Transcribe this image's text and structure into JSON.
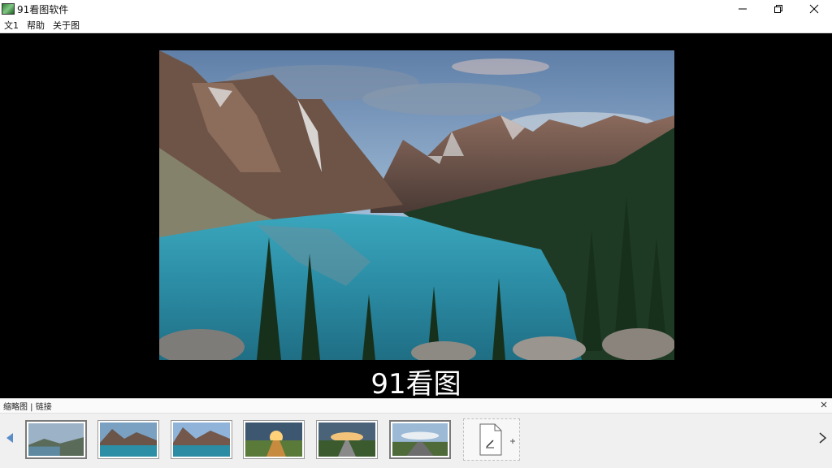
{
  "window": {
    "title": "91看图软件"
  },
  "menu": {
    "items": [
      "文1",
      "帮助",
      "关于图"
    ]
  },
  "viewer": {
    "caption": "91看图"
  },
  "filmstrip": {
    "title": "缩略图 | 链接"
  },
  "colors": {
    "sky": "#8fb3d9",
    "lake": "#2c8fa6",
    "forest": "#23402a",
    "rock": "#6b4f42"
  }
}
